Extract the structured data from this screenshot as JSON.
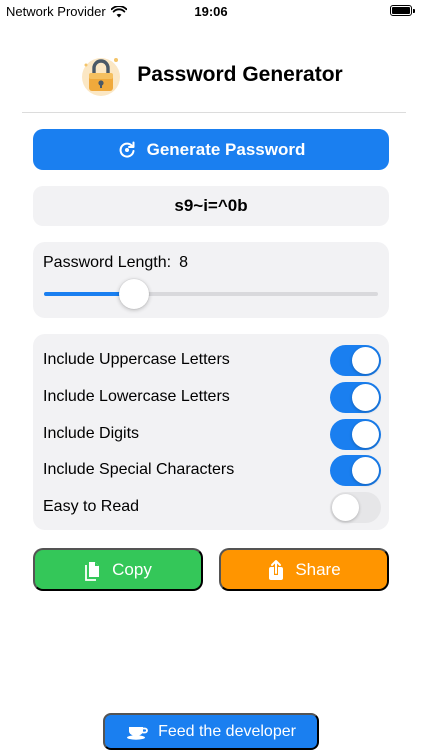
{
  "status_bar": {
    "carrier": "Network Provider",
    "time": "19:06",
    "icons": [
      "wifi-icon",
      "battery-icon"
    ]
  },
  "header": {
    "title": "Password Generator",
    "logo_icon": "lock-icon"
  },
  "generate_button": {
    "label": "Generate Password",
    "icon": "refresh-icon"
  },
  "password": {
    "value": "s9~i=^0b"
  },
  "length": {
    "label": "Password Length:",
    "value": "8",
    "slider_fraction": 0.27
  },
  "options": [
    {
      "label": "Include Uppercase Letters",
      "on": true
    },
    {
      "label": "Include Lowercase Letters",
      "on": true
    },
    {
      "label": "Include Digits",
      "on": true
    },
    {
      "label": "Include Special Characters",
      "on": true
    },
    {
      "label": "Easy to Read",
      "on": false
    }
  ],
  "copy_button": {
    "label": "Copy",
    "icon": "document-copy-icon"
  },
  "share_button": {
    "label": "Share",
    "icon": "share-icon"
  },
  "feed_button": {
    "label": "Feed the developer",
    "icon": "coffee-cup-icon"
  },
  "colors": {
    "accent": "#1a7ff0",
    "copy": "#34c759",
    "share": "#ff9500",
    "card": "#f2f2f4"
  }
}
